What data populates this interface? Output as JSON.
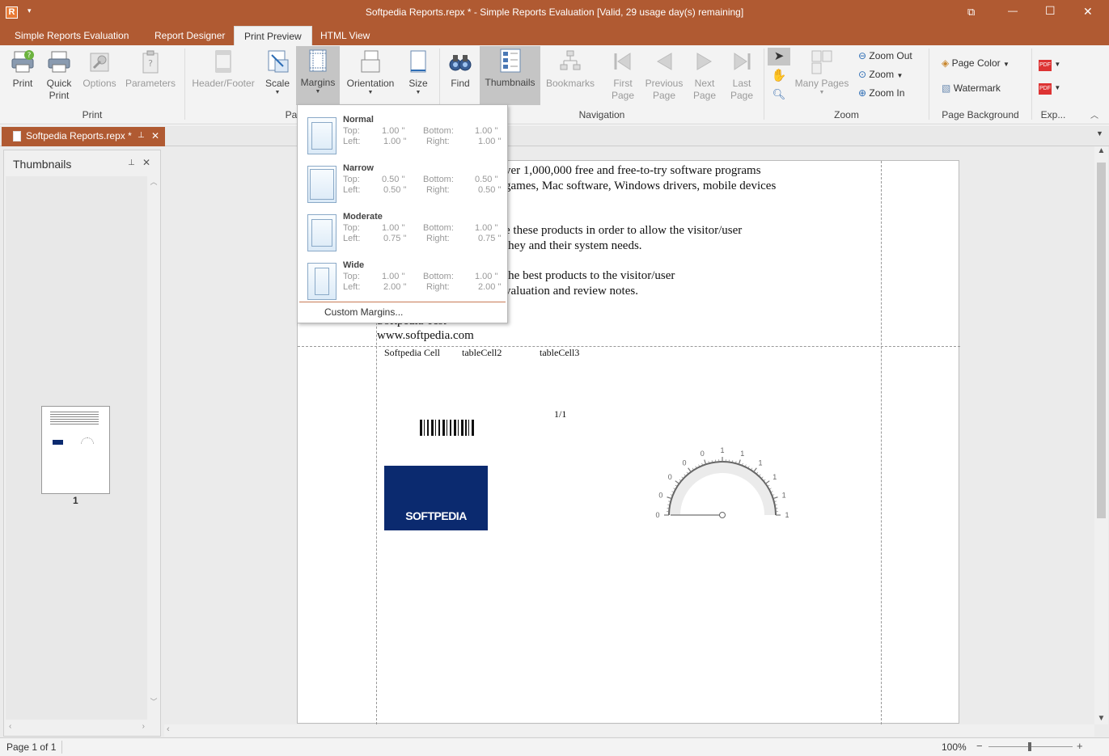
{
  "window": {
    "app_icon_letter": "R",
    "title": "Softpedia Reports.repx * - Simple Reports Evaluation [Valid,  29 usage day(s) remaining]",
    "controls": {
      "restore": "⧉",
      "minimize": "—",
      "maximize": "☐",
      "close": "✕"
    }
  },
  "ribbon_tabs": [
    {
      "label": "Simple Reports Evaluation"
    },
    {
      "label": "Report Designer"
    },
    {
      "label": "Print Preview"
    },
    {
      "label": "HTML View"
    }
  ],
  "ribbon": {
    "print_group": {
      "label": "Print",
      "print": "Print",
      "quick_print_1": "Quick",
      "quick_print_2": "Print",
      "options": "Options",
      "parameters": "Parameters"
    },
    "page_group": {
      "label": "Pa",
      "header_footer": "Header/Footer",
      "scale": "Scale",
      "margins": "Margins",
      "orientation": "Orientation",
      "size": "Size"
    },
    "find": "Find",
    "navigation_group": {
      "label": "Navigation",
      "thumbnails": "Thumbnails",
      "bookmarks": "Bookmarks",
      "first_1": "First",
      "first_2": "Page",
      "prev_1": "Previous",
      "prev_2": "Page",
      "next_1": "Next",
      "next_2": "Page",
      "last_1": "Last",
      "last_2": "Page"
    },
    "zoom_group": {
      "label": "Zoom",
      "many_pages": "Many Pages",
      "zoom_out": "Zoom Out",
      "zoom": "Zoom",
      "zoom_in": "Zoom In"
    },
    "background_group": {
      "label": "Page Background",
      "page_color": "Page Color",
      "watermark": "Watermark"
    },
    "export_group": {
      "label": "Exp..."
    }
  },
  "doc_tab": {
    "label": "Softpedia Reports.repx *"
  },
  "thumbnails_panel": {
    "title": "Thumbnails",
    "page_number": "1"
  },
  "margins_menu": {
    "presets": [
      {
        "name": "Normal",
        "top": "1.00 \"",
        "bottom": "1.00 \"",
        "left": "1.00 \"",
        "right": "1.00 \""
      },
      {
        "name": "Narrow",
        "top": "0.50 \"",
        "bottom": "0.50 \"",
        "left": "0.50 \"",
        "right": "0.50 \""
      },
      {
        "name": "Moderate",
        "top": "1.00 \"",
        "bottom": "1.00 \"",
        "left": "0.75 \"",
        "right": "0.75 \""
      },
      {
        "name": "Wide",
        "top": "1.00 \"",
        "bottom": "1.00 \"",
        "left": "2.00 \"",
        "right": "2.00 \""
      }
    ],
    "labels": {
      "top": "Top:",
      "bottom": "Bottom:",
      "left": "Left:",
      "right": "Right:"
    },
    "custom": "Custom Margins..."
  },
  "report_page": {
    "lines": [
      "ver 1,000,000 free and free-to-try software programs",
      "games, Mac software, Windows drivers, mobile devices",
      "e these products in order to allow the visitor/user",
      "they and their system needs.",
      "the best products to the visitor/user",
      "valuation and review notes.",
      "Softpedia Test",
      "www.softpedia.com"
    ],
    "cells": [
      "Softpedia Cell",
      "tableCell2",
      "tableCell3"
    ],
    "page_counter": "1/1",
    "logo_text": "SOFTPEDIA",
    "gauge_labels": [
      "0",
      "0",
      "0",
      "0",
      "0",
      "1",
      "1",
      "1",
      "1",
      "1",
      "1"
    ]
  },
  "status": {
    "page": "Page 1 of 1",
    "zoom": "100%",
    "minus": "−",
    "plus": "+"
  },
  "colors": {
    "accent": "#b05a32",
    "selected_button": "#c5c5c5",
    "logo_bg": "#0b2a6f"
  }
}
